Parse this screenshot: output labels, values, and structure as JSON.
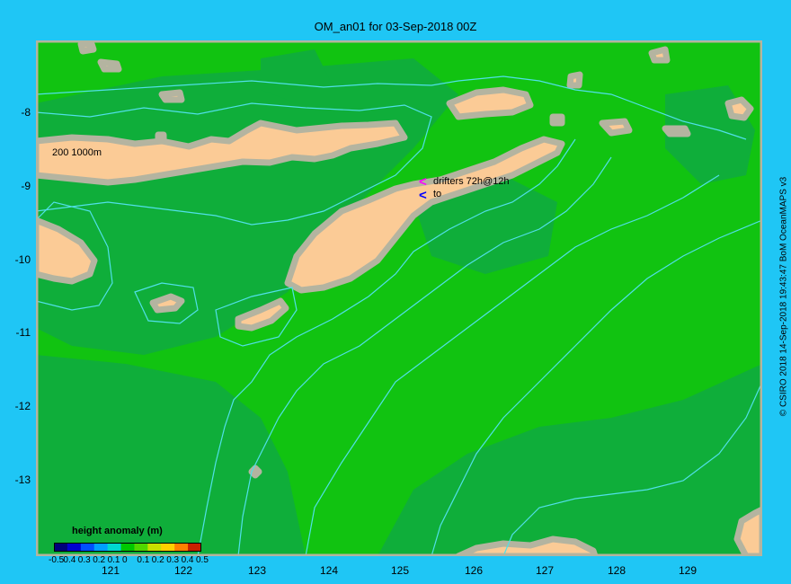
{
  "title": "OM_an01 for 03-Sep-2018 00Z",
  "credit": "© CSIRO 2018   14-Sep-2018 19:43:47 BoM OceanMAPS v3",
  "axes": {
    "y_ticks": [
      "-8",
      "-9",
      "-10",
      "-11",
      "-12",
      "-13"
    ],
    "x_ticks": [
      "121",
      "122",
      "123",
      "124",
      "125",
      "126",
      "127",
      "128",
      "129"
    ]
  },
  "contour_label": "200  1000m",
  "drifters": {
    "label1": "drifters 72h@12h",
    "label2": "to",
    "color1": "#ff00ff",
    "color2": "#0000ff"
  },
  "legend": {
    "title": "height anomaly  (m)",
    "labels": [
      "-0.5",
      "0.4",
      "0.3",
      "0.2",
      "0.1",
      "0",
      "0.1",
      "0.2",
      "0.3",
      "0.4",
      "0.5"
    ],
    "colors": [
      "#00007a",
      "#0000d0",
      "#0050ff",
      "#00a0ff",
      "#00d8d0",
      "#00c800",
      "#50d800",
      "#c8e000",
      "#ffd000",
      "#ff8000",
      "#c82000"
    ]
  },
  "colors": {
    "background": "#1fc6f5",
    "ocean": "#11c311",
    "ocean_dark": "#0fae3a",
    "land": "#fbcb96",
    "shelf": "#b4b4a0",
    "contour": "#50e0e8"
  }
}
